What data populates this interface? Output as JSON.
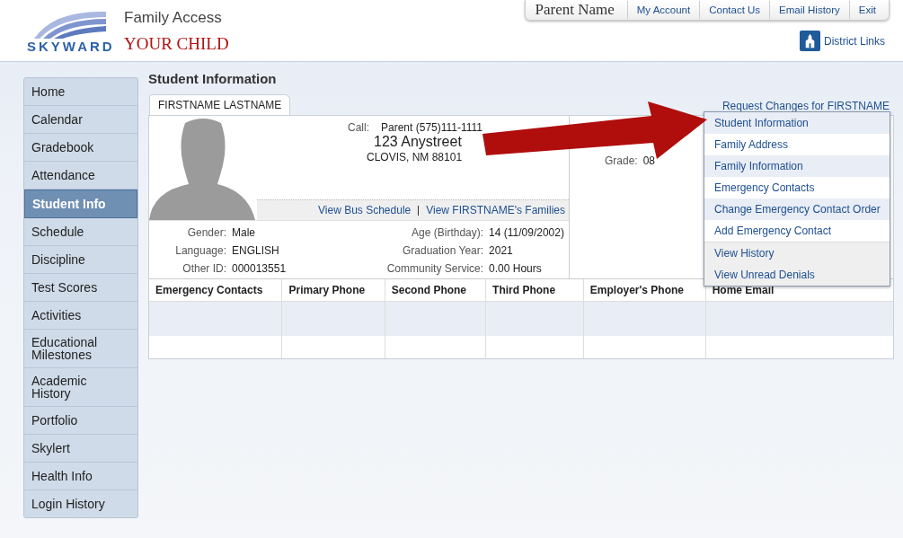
{
  "header": {
    "logo_text": "SKYWARD",
    "app_title": "Family Access",
    "child_name": "YOUR CHILD",
    "parent_name": "Parent Name",
    "top_links": [
      "My Account",
      "Contact Us",
      "Email History",
      "Exit"
    ],
    "district_links": "District Links"
  },
  "sidebar": {
    "items": [
      {
        "label": "Home",
        "selected": false
      },
      {
        "label": "Calendar",
        "selected": false
      },
      {
        "label": "Gradebook",
        "selected": false
      },
      {
        "label": "Attendance",
        "selected": false
      },
      {
        "label": "Student Info",
        "selected": true
      },
      {
        "label": "Schedule",
        "selected": false
      },
      {
        "label": "Discipline",
        "selected": false
      },
      {
        "label": "Test Scores",
        "selected": false
      },
      {
        "label": "Activities",
        "selected": false
      },
      {
        "label": "Educational Milestones",
        "selected": false
      },
      {
        "label": "Academic History",
        "selected": false
      },
      {
        "label": "Portfolio",
        "selected": false
      },
      {
        "label": "Skylert",
        "selected": false
      },
      {
        "label": "Health Info",
        "selected": false
      },
      {
        "label": "Login History",
        "selected": false
      }
    ]
  },
  "page_title": "Student Information",
  "student_tab": "FIRSTNAME LASTNAME",
  "request_link": "Request Changes for FIRSTNAME",
  "contact": {
    "call_label": "Call:",
    "call_value": "Parent (575)111-1111",
    "street": "123 Anystreet",
    "city": "CLOVIS, NM 88101"
  },
  "links": [
    "View Bus Schedule",
    "View FIRSTNAME's Families"
  ],
  "fields_left": [
    {
      "label": "Gender:",
      "value": "Male"
    },
    {
      "label": "Language:",
      "value": "ENGLISH"
    },
    {
      "label": "Other ID:",
      "value": "000013551"
    }
  ],
  "fields_right": [
    {
      "label": "Age (Birthday):",
      "value": "14 (11/09/2002)"
    },
    {
      "label": "Graduation Year:",
      "value": "2021"
    },
    {
      "label": "Community Service:",
      "value": "0.00 Hours"
    }
  ],
  "grade": {
    "label": "Grade:",
    "value": "08"
  },
  "request_menu": {
    "request_items": [
      "Student Information",
      "Family Address",
      "Family Information",
      "Emergency Contacts",
      "Change Emergency Contact Order",
      "Add Emergency Contact"
    ],
    "history_items": [
      "View History",
      "View Unread Denials"
    ]
  },
  "contacts_table": {
    "columns": [
      "Emergency Contacts",
      "Primary Phone",
      "Second Phone",
      "Third Phone",
      "Employer's Phone",
      "Home Email"
    ]
  }
}
